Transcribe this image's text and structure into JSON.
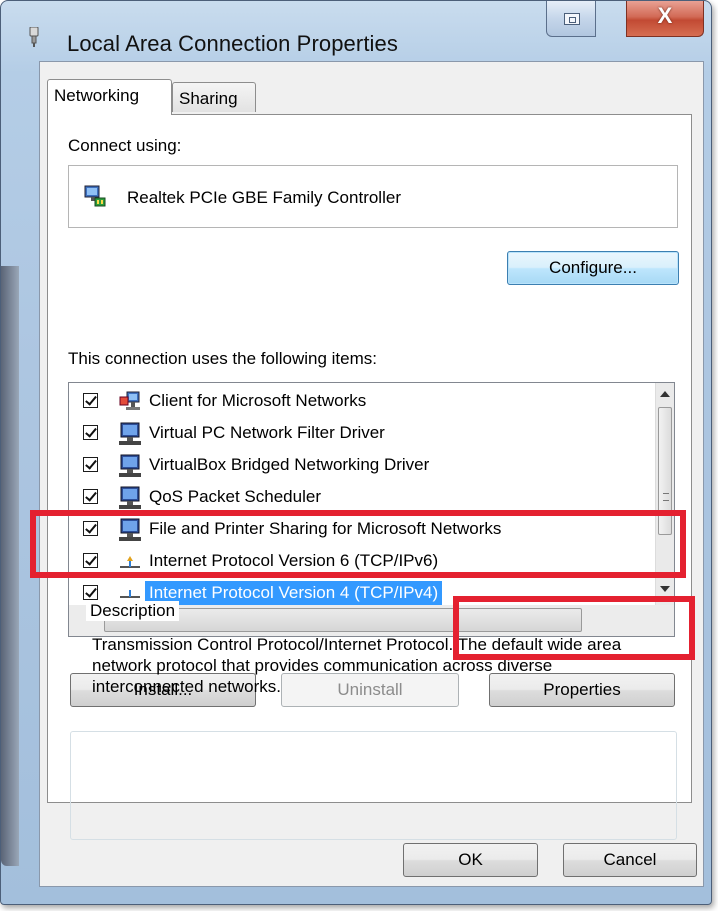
{
  "window": {
    "title": "Local Area Connection Properties",
    "close_glyph": "X",
    "restore_icon": "restore-icon"
  },
  "tabs": [
    {
      "label": "Networking",
      "active": true
    },
    {
      "label": "Sharing",
      "active": false
    }
  ],
  "networking": {
    "connect_using_label": "Connect using:",
    "adapter_name": "Realtek PCIe GBE Family Controller",
    "configure_button": "Configure...",
    "items_label": "This connection uses the following items:",
    "items": [
      {
        "label": "Client for Microsoft Networks",
        "checked": true,
        "icon": "network-client-icon"
      },
      {
        "label": "Virtual PC Network Filter Driver",
        "checked": true,
        "icon": "network-service-icon"
      },
      {
        "label": "VirtualBox Bridged Networking Driver",
        "checked": true,
        "icon": "network-service-icon"
      },
      {
        "label": "QoS Packet Scheduler",
        "checked": true,
        "icon": "network-service-icon"
      },
      {
        "label": "File and Printer Sharing for Microsoft Networks",
        "checked": true,
        "icon": "network-service-icon"
      },
      {
        "label": "Internet Protocol Version 6 (TCP/IPv6)",
        "checked": true,
        "icon": "protocol-icon"
      },
      {
        "label": "Internet Protocol Version 4 (TCP/IPv4)",
        "checked": true,
        "icon": "protocol-icon",
        "selected": true
      }
    ],
    "install_button": "Install...",
    "uninstall_button": "Uninstall",
    "properties_button": "Properties",
    "description_title": "Description",
    "description_text": "Transmission Control Protocol/Internet Protocol. The default wide area network protocol that provides communication across diverse interconnected networks."
  },
  "footer": {
    "ok_button": "OK",
    "cancel_button": "Cancel"
  },
  "colors": {
    "highlight_red": "#e42130",
    "selection_blue": "#3399ff"
  }
}
